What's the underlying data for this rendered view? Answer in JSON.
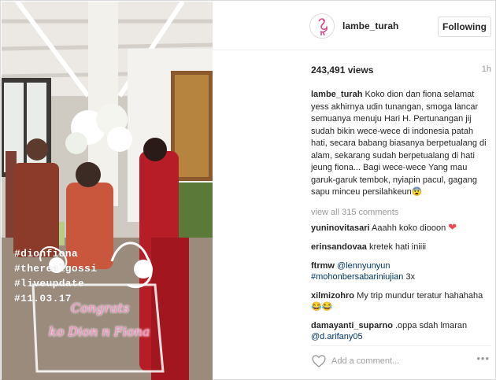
{
  "header": {
    "username": "lambe_turah",
    "follow_label": "Following"
  },
  "stats": {
    "views": "243,491 views",
    "age": "1h"
  },
  "media": {
    "overlay_tags": [
      "#dionfiona",
      "#therealgossi",
      "#liveupdate",
      "#11.03.17"
    ],
    "handwriting_line1": "Congrats",
    "handwriting_line2": "ko Dion n Fiona"
  },
  "caption": {
    "username": "lambe_turah",
    "text": "Koko dion dan fiona selamat yess akhirnya udin tunangan, smoga lancar semuanya menuju Hari H. Pertunangan jij sudah bikin wece-wece di indonesia patah hati, secara babang biasanya berpetualang di alam, sekarang sudah berpetualang di hati jeung fiona... Bagi wece-wece Yang mau garuk-garuk tembok, nyiapin pacul, gagang sapu minceu persilahkeun",
    "emoji": "😨"
  },
  "view_all_comments": "view all 315 comments",
  "comments": [
    {
      "user": "yuninovitasari",
      "text": "Aaahh koko diooon",
      "suffix": "❤"
    },
    {
      "user": "erinsandovaa",
      "text": "kretek hati iniiii",
      "suffix": ""
    },
    {
      "user": "ftrmw",
      "mention": "@lennyunyun",
      "text": "3x",
      "hashtag": "#mohonbersabariniujian"
    },
    {
      "user": "xilmizohro",
      "text": "My trip mundur teratur hahahaha",
      "suffix": "😂😂"
    },
    {
      "user": "damayanti_suparno",
      "text": ".oppa sdah lmaran",
      "mention": "@d.arifany05"
    }
  ],
  "add_comment": {
    "placeholder": "Add a comment..."
  },
  "icons": {
    "like": "heart-outline-icon",
    "more": "more-options-icon",
    "avatar": "flamingo-logo-icon"
  }
}
